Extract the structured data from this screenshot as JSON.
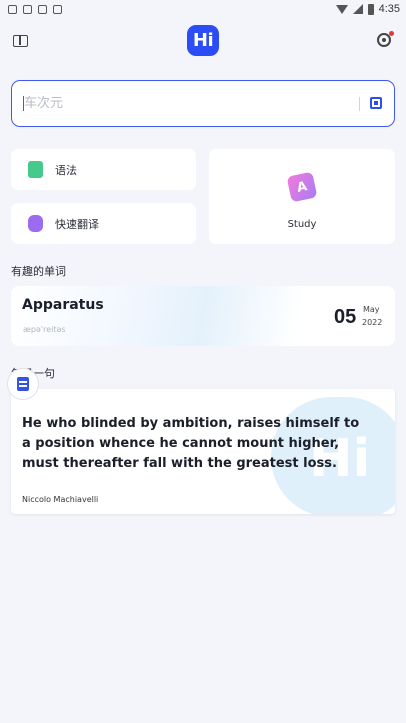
{
  "status_bar": {
    "time": "4:35",
    "icons": [
      "notification-icon",
      "sync-icon",
      "sim-icon",
      "download-icon",
      "wifi-icon",
      "signal-icon",
      "battery-icon"
    ]
  },
  "header": {
    "logo_text": "Hi",
    "accent_color": "#2c4cf5",
    "settings_has_notification": true
  },
  "search": {
    "placeholder": "车次元",
    "value": ""
  },
  "tools": {
    "grammar_label": "语法",
    "translate_label": "快速翻译",
    "study_label": "Study",
    "study_icon_letter": "A"
  },
  "interesting_words": {
    "title": "有趣的单词",
    "word": "Apparatus",
    "phonetic": "æpəˈreitəs",
    "day": "05",
    "month": "May",
    "year": "2022"
  },
  "daily_sentence": {
    "title": "每日一句",
    "quote": "He who blinded by ambition, raises himself to a position whence he cannot mount higher, must thereafter fall with the greatest loss.",
    "author": "Niccolo Machiavelli",
    "watermark": "Hi"
  }
}
